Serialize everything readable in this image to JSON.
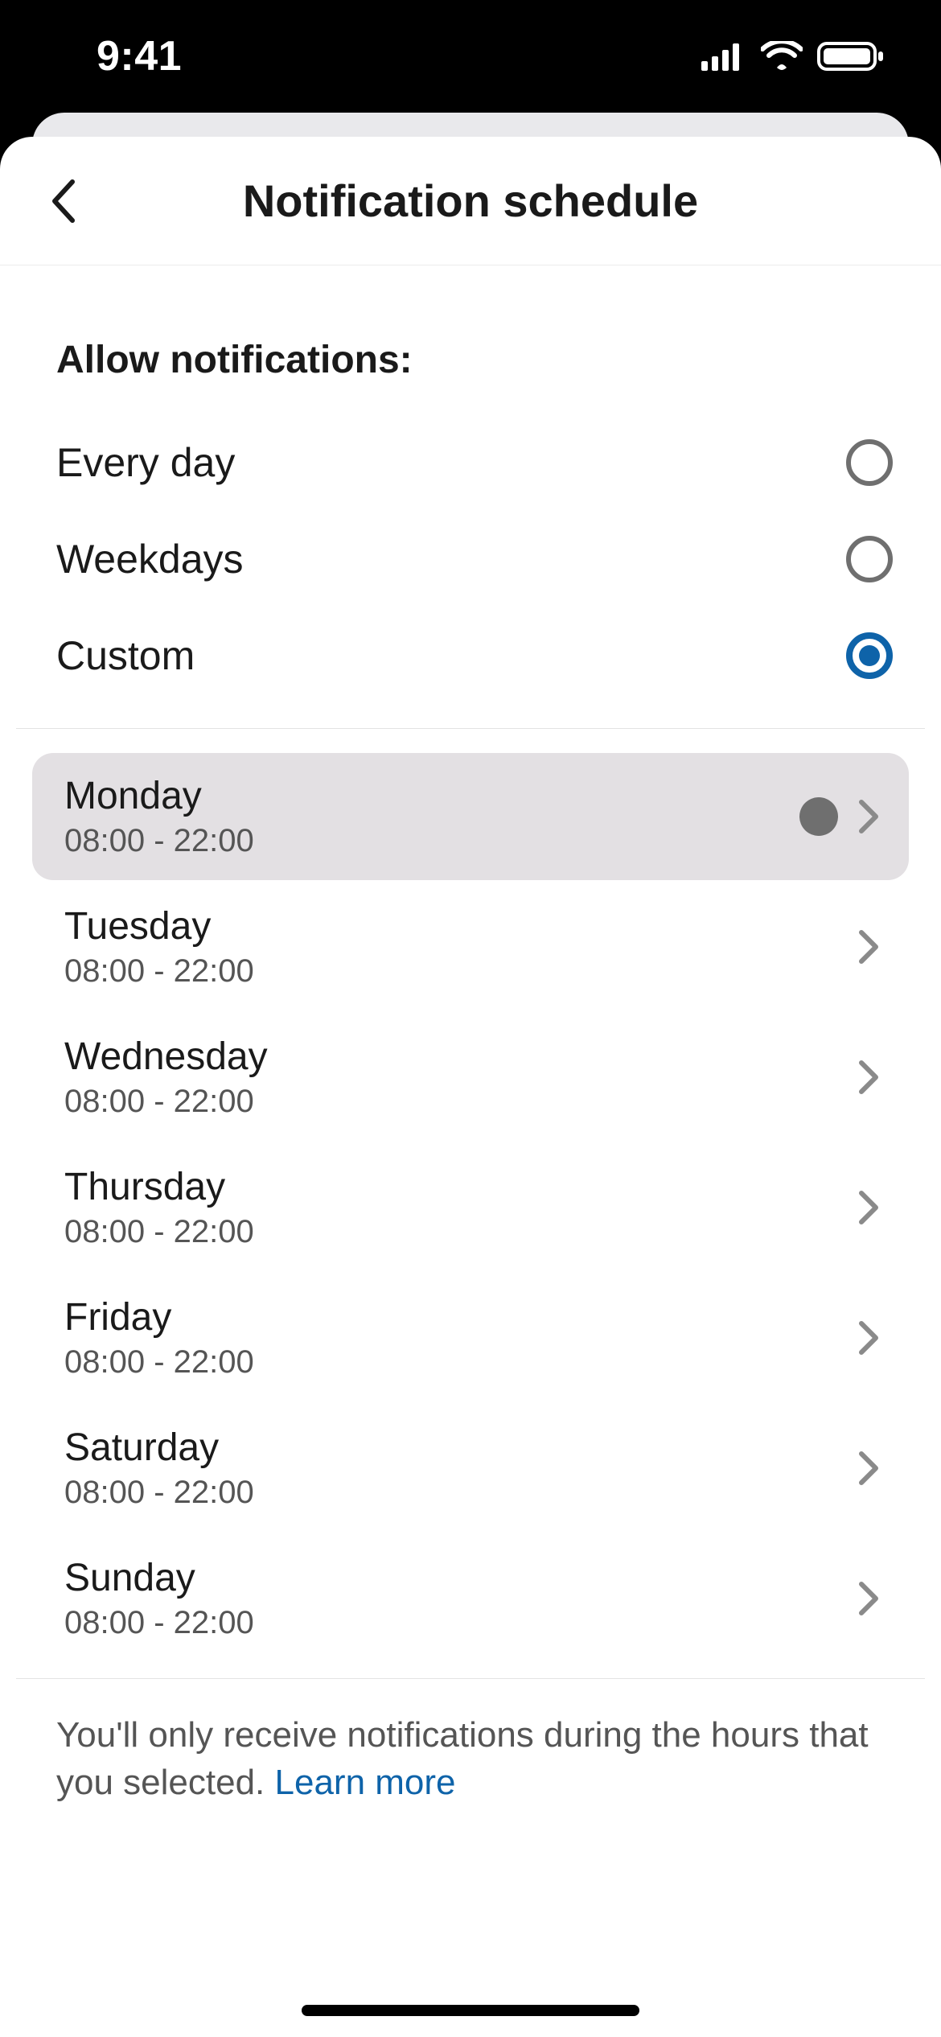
{
  "status": {
    "time": "9:41"
  },
  "header": {
    "title": "Notification schedule"
  },
  "section_label": "Allow notifications:",
  "options": [
    {
      "label": "Every day",
      "selected": false
    },
    {
      "label": "Weekdays",
      "selected": false
    },
    {
      "label": "Custom",
      "selected": true
    }
  ],
  "days": [
    {
      "name": "Monday",
      "range": "08:00 - 22:00",
      "highlight": true,
      "dot": true
    },
    {
      "name": "Tuesday",
      "range": "08:00 - 22:00",
      "highlight": false,
      "dot": false
    },
    {
      "name": "Wednesday",
      "range": "08:00 - 22:00",
      "highlight": false,
      "dot": false
    },
    {
      "name": "Thursday",
      "range": "08:00 - 22:00",
      "highlight": false,
      "dot": false
    },
    {
      "name": "Friday",
      "range": "08:00 - 22:00",
      "highlight": false,
      "dot": false
    },
    {
      "name": "Saturday",
      "range": "08:00 - 22:00",
      "highlight": false,
      "dot": false
    },
    {
      "name": "Sunday",
      "range": "08:00 - 22:00",
      "highlight": false,
      "dot": false
    }
  ],
  "footer": {
    "text": "You'll only receive notifications during the hours that you selected. ",
    "link": "Learn more"
  },
  "colors": {
    "accent": "#0e63a9"
  }
}
